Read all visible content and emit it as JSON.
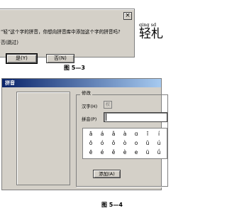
{
  "fig3": {
    "close_glyph": "×",
    "message": "“轻”这个字的拼音，你想向拼音库中添加这个字的拼音吗?",
    "option": "否(跳过)",
    "yes_label": "是(Y)",
    "no_label": "否(N)",
    "caption": "图 5—3"
  },
  "side": {
    "pinyin": "qing sd",
    "char": "轻札"
  },
  "fig4": {
    "title": "拼音",
    "group_label": "修改",
    "hanzi_label": "汉字(H)",
    "hanzi_value": "权",
    "pinyin_label": "拼音(P)",
    "pinyin_value": "",
    "tone_rows": [
      [
        "ā",
        "á",
        "ǎ",
        "à",
        "ɑ",
        "ī",
        "í"
      ],
      [
        "ō",
        "ó",
        "ǒ",
        "ò",
        "o",
        "ū",
        "ú"
      ],
      [
        "ē",
        "é",
        "ě",
        "è",
        "e",
        "ü",
        "ǘ"
      ]
    ],
    "add_label": "添加(A)",
    "caption": "图 5—4"
  }
}
